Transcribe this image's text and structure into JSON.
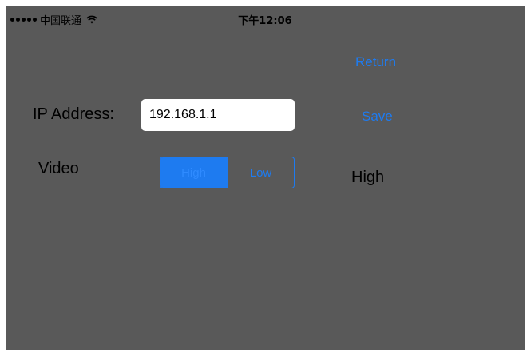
{
  "status_bar": {
    "carrier": "中国联通",
    "time": "下午12:06",
    "signal_bars": 5
  },
  "nav": {
    "return_label": "Return",
    "save_label": "Save"
  },
  "form": {
    "ip_label": "IP Address:",
    "ip_value": "192.168.1.1",
    "video_label": "Video",
    "video_options": [
      "High",
      "Low"
    ],
    "video_selected": "High",
    "video_value_display": "High"
  },
  "colors": {
    "background": "#595959",
    "accent": "#1e7bf0",
    "text": "#000000",
    "input_bg": "#ffffff"
  },
  "icons": {
    "signal": "signal-dots-icon",
    "wifi": "wifi-icon"
  }
}
